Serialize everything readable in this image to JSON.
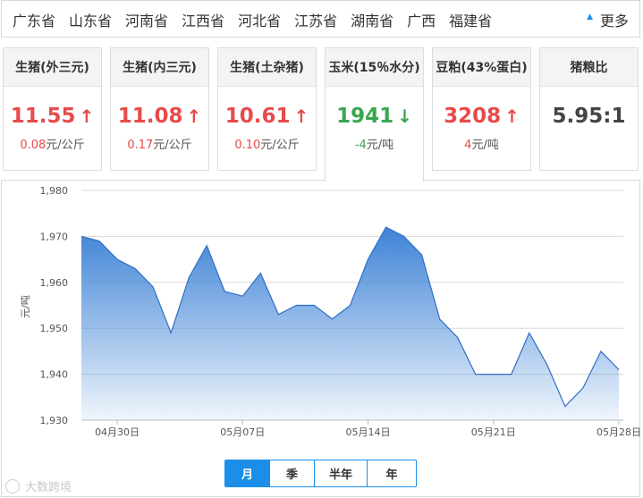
{
  "provinces": [
    "广东省",
    "山东省",
    "河南省",
    "江西省",
    "河北省",
    "江苏省",
    "湖南省",
    "广西",
    "福建省"
  ],
  "more_label": "更多",
  "cards": [
    {
      "title": "生猪(外三元)",
      "price": "11.55",
      "trend": "up",
      "change_num": "0.08",
      "change_unit": "元/公斤"
    },
    {
      "title": "生猪(内三元)",
      "price": "11.08",
      "trend": "up",
      "change_num": "0.17",
      "change_unit": "元/公斤"
    },
    {
      "title": "生猪(土杂猪)",
      "price": "10.61",
      "trend": "up",
      "change_num": "0.10",
      "change_unit": "元/公斤"
    },
    {
      "title": "玉米(15％水分)",
      "price": "1941",
      "trend": "down",
      "change_num": "-4",
      "change_unit": "元/吨"
    },
    {
      "title": "豆粕(43%蛋白)",
      "price": "3208",
      "trend": "up",
      "change_num": "4",
      "change_unit": "元/吨"
    },
    {
      "title": "猪粮比",
      "price": "5.95:1",
      "trend": "none",
      "change_num": "",
      "change_unit": ""
    }
  ],
  "active_card": 3,
  "period_tabs": [
    "月",
    "季",
    "半年",
    "年"
  ],
  "active_tab": 0,
  "watermark": "大数跨境",
  "colors": {
    "up": "#e84a4a",
    "down": "#3aa650",
    "accent": "#1a8ee8",
    "area_top": "#3e83d6"
  },
  "chart_data": {
    "type": "area",
    "ylabel": "元/吨",
    "ylim": [
      1930,
      1980
    ],
    "yticks": [
      "1,930",
      "1,940",
      "1,950",
      "1,960",
      "1,970",
      "1,980"
    ],
    "xticks": [
      "04月30日",
      "05月07日",
      "05月14日",
      "05月21日",
      "05月28日"
    ],
    "xtick_index": [
      2,
      9,
      16,
      23,
      30
    ],
    "values": [
      1970,
      1969,
      1965,
      1963,
      1959,
      1949,
      1961,
      1968,
      1958,
      1957,
      1962,
      1953,
      1955,
      1955,
      1952,
      1955,
      1965,
      1972,
      1970,
      1966,
      1952,
      1948,
      1940,
      1940,
      1940,
      1949,
      1942,
      1933,
      1937,
      1945,
      1941
    ]
  }
}
